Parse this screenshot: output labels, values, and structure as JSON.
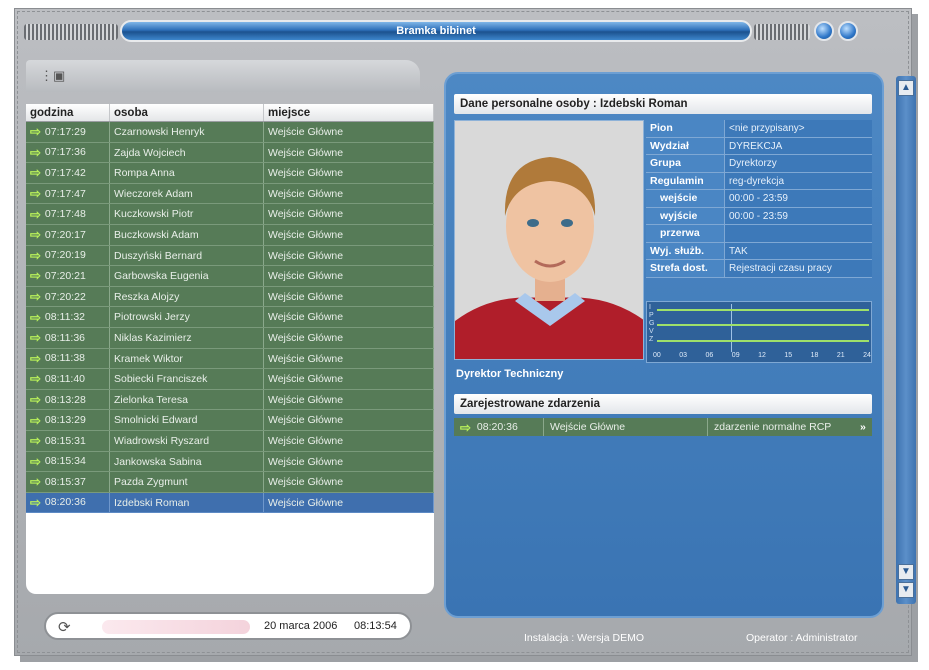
{
  "window": {
    "title": "Bramka bibinet"
  },
  "list": {
    "headers": [
      "godzina",
      "osoba",
      "miejsce"
    ],
    "rows": [
      {
        "time": "07:17:29",
        "person": "Czarnowski Henryk",
        "place": "Wejście Główne"
      },
      {
        "time": "07:17:36",
        "person": "Zajda Wojciech",
        "place": "Wejście Główne"
      },
      {
        "time": "07:17:42",
        "person": "Rompa Anna",
        "place": "Wejście Główne"
      },
      {
        "time": "07:17:47",
        "person": "Wieczorek Adam",
        "place": "Wejście Główne"
      },
      {
        "time": "07:17:48",
        "person": "Kuczkowski Piotr",
        "place": "Wejście Główne"
      },
      {
        "time": "07:20:17",
        "person": "Buczkowski Adam",
        "place": "Wejście Główne"
      },
      {
        "time": "07:20:19",
        "person": "Duszyński Bernard",
        "place": "Wejście Główne"
      },
      {
        "time": "07:20:21",
        "person": "Garbowska Eugenia",
        "place": "Wejście Główne"
      },
      {
        "time": "07:20:22",
        "person": "Reszka Alojzy",
        "place": "Wejście Główne"
      },
      {
        "time": "08:11:32",
        "person": "Piotrowski Jerzy",
        "place": "Wejście Główne"
      },
      {
        "time": "08:11:36",
        "person": "Niklas Kazimierz",
        "place": "Wejście Główne"
      },
      {
        "time": "08:11:38",
        "person": "Kramek Wiktor",
        "place": "Wejście Główne"
      },
      {
        "time": "08:11:40",
        "person": "Sobiecki Franciszek",
        "place": "Wejście Główne"
      },
      {
        "time": "08:13:28",
        "person": "Zielonka Teresa",
        "place": "Wejście Główne"
      },
      {
        "time": "08:13:29",
        "person": "Smolnicki Edward",
        "place": "Wejście Główne"
      },
      {
        "time": "08:15:31",
        "person": "Wiadrowski Ryszard",
        "place": "Wejście Główne"
      },
      {
        "time": "08:15:34",
        "person": "Jankowska Sabina",
        "place": "Wejście Główne"
      },
      {
        "time": "08:15:37",
        "person": "Pazda Zygmunt",
        "place": "Wejście Główne"
      },
      {
        "time": "08:20:36",
        "person": "Izdebski Roman",
        "place": "Wejście Główne",
        "selected": true
      }
    ]
  },
  "status": {
    "date": "20 marca 2006",
    "time": "08:13:54"
  },
  "detail": {
    "header": "Dane personalne osoby : Izdebski Roman",
    "fields": [
      {
        "key": "Pion",
        "value": "<nie przypisany>"
      },
      {
        "key": "Wydział",
        "value": "DYREKCJA"
      },
      {
        "key": "Grupa",
        "value": "Dyrektorzy"
      },
      {
        "key": "Regulamin",
        "value": "reg-dyrekcja"
      },
      {
        "key": "wejście",
        "value": "00:00 - 23:59",
        "indent": true
      },
      {
        "key": "wyjście",
        "value": "00:00 - 23:59",
        "indent": true
      },
      {
        "key": "przerwa",
        "value": "",
        "indent": true
      },
      {
        "key": "Wyj. służb.",
        "value": "TAK"
      },
      {
        "key": "Strefa dost.",
        "value": "Rejestracji czasu pracy"
      }
    ],
    "graph_letters": [
      "I",
      "P",
      "G",
      "V",
      "Z"
    ],
    "graph_ticks": [
      "00",
      "03",
      "06",
      "09",
      "12",
      "15",
      "18",
      "21",
      "24"
    ],
    "role": "Dyrektor Techniczny",
    "events_header": "Zarejestrowane zdarzenia",
    "event": {
      "time": "08:20:36",
      "place": "Wejście Główne",
      "type": "zdarzenie normalne RCP",
      "more": "»"
    }
  },
  "footer": {
    "install": "Instalacja : Wersja DEMO",
    "operator": "Operator : Administrator"
  },
  "icons": {
    "row_arrow": "arrow-right-icon",
    "accent": "#b8f05a"
  }
}
